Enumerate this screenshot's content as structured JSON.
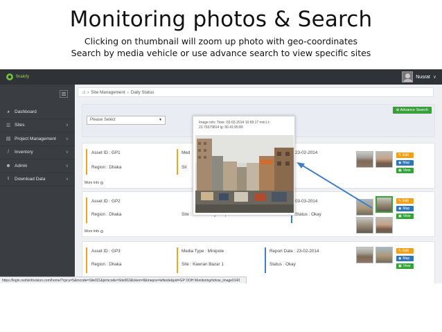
{
  "slide": {
    "title": "Monitoring photos & Search",
    "subtitle1": "Clicking on thumbnail will zoom up photo with geo-coordinates",
    "subtitle2": "Search by media vehicle or use advance search to view specific sites"
  },
  "topbar": {
    "brand": "finalofy",
    "user_name": "Nusrat",
    "user_caret": "∨"
  },
  "sidebar": {
    "items": [
      {
        "label": "Dashboard",
        "icon": "◕"
      },
      {
        "label": "Sites",
        "icon": "☰"
      },
      {
        "label": "Project Management",
        "icon": "▤"
      },
      {
        "label": "Inventory",
        "icon": "/"
      },
      {
        "label": "Admin",
        "icon": "☻"
      },
      {
        "label": "Download Data",
        "icon": "⭳"
      }
    ]
  },
  "breadcrumb": {
    "home_icon": "⌂",
    "sep": "›",
    "section": "Site Management",
    "page": "Daily Status"
  },
  "search": {
    "select_value": "Please Select",
    "advance_label": "Advance Search",
    "advance_icon": "⊕"
  },
  "cards": [
    {
      "asset": "Asset ID : GP1",
      "region": "Region : Dhaka",
      "media": "Med",
      "site": "Sit",
      "report": "23-02-2014",
      "status": "",
      "more": "More Info"
    },
    {
      "asset": "Asset ID : GP2",
      "region": "Region : Dhaka",
      "media": "",
      "site": "Site : Dohar Bangla Squire",
      "report": "03-03-2014",
      "status": "Status : Okay",
      "more": "More Info"
    },
    {
      "asset": "Asset ID : GP3",
      "region": "Region : Dhaka",
      "media": "Media Type : Minipole",
      "site": "Site : Kawran Bazar 1",
      "report": "Report Date : 23-02-2014",
      "status": "Status : Okay",
      "more": "More Info"
    }
  ],
  "buttons": {
    "edit": "Edit",
    "map": "Map",
    "view": "View"
  },
  "popup": {
    "info": "Image info: Time :03-03-2014 10:58:17 mm Lt: 23.79379814 lg: 90.41:95:89"
  },
  "statusbar": {
    "url": "https://login.roofsinfovision.com/home/?cpcu=5&mcode=Site021&prmcode=Site002&token=8&mepos=lefteide&pid=GP OOH Monitoring#show_image0143"
  },
  "colors": {
    "accent_green": "#3a9e3a",
    "edit_orange": "#f0a11b",
    "map_blue": "#2c75b8",
    "sidebar_bg": "#3a3d42",
    "topbar_bg": "#2f3236",
    "arrow_blue": "#3f7fc7"
  }
}
